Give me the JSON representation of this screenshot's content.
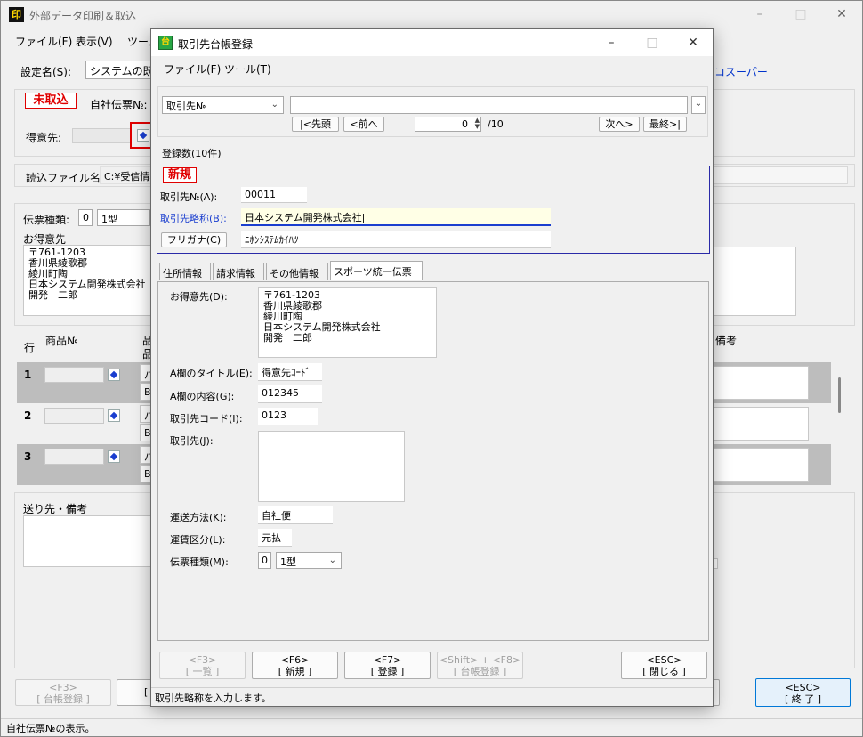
{
  "main": {
    "title": "外部データ印刷＆取込",
    "menu": [
      "ファイル(F)",
      "表示(V)",
      "ツール"
    ],
    "setting_label": "設定名(S):",
    "setting_value": "システムの既定",
    "link_right": "コスーパー",
    "status_badge": "未取込",
    "slip_no_label": "自社伝票№:",
    "customer_label": "得意先:",
    "file_label": "読込ファイル名:",
    "file_value": "C:¥受信情報",
    "slip_type_label": "伝票種類:",
    "slip_type_code": "0",
    "slip_type_value": "1型",
    "okyakusaki_label": "お得意先",
    "okyakusaki_text": "〒761-1203\n香川県綾歌郡\n綾川町陶\n日本システム開発株式会社\n開発　二郎",
    "grid_row_header": "行",
    "grid_product_header": "商品№",
    "grid_product2_header": "品",
    "grid_product3_header": "品",
    "grid_biko_header": "備考",
    "rows": [
      {
        "no": "1",
        "p1": "パ",
        "p2": "B"
      },
      {
        "no": "2",
        "p1": "パ",
        "p2": "B"
      },
      {
        "no": "3",
        "p1": "パ",
        "p2": "B"
      }
    ],
    "okuri_label": "送り先・備考",
    "f3_key": "<F3>",
    "f3_label": "[ 台帳登録 ]",
    "f_hidden_label": "[",
    "esc_key": "<ESC>",
    "esc_label": "[ 終 了 ]",
    "status_bar": "自社伝票№の表示。"
  },
  "dialog": {
    "title": "取引先台帳登録",
    "menu": [
      "ファイル(F)",
      "ツール(T)"
    ],
    "search_field": "取引先№",
    "nav_first": "|<先頭",
    "nav_prev": "<前へ",
    "nav_pos": "0",
    "nav_total": "/10",
    "nav_next": "次へ>",
    "nav_last": "最終>|",
    "count_label": "登録数(10件)",
    "new_badge": "新規",
    "torihiki_no_label": "取引先№(A):",
    "torihiki_no_value": "00011",
    "ryakusho_label": "取引先略称(B):",
    "ryakusho_value": "日本システム開発株式会社",
    "furigana_button": "フリガナ(C)",
    "furigana_value": "ﾆﾎﾝｼｽﾃﾑｶｲﾊﾂ",
    "tabs": [
      "住所情報",
      "請求情報",
      "その他情報",
      "スポーツ統一伝票"
    ],
    "okyakusaki_label": "お得意先(D):",
    "okyakusaki_text": "〒761-1203\n香川県綾歌郡\n綾川町陶\n日本システム開発株式会社\n開発　二郎",
    "a_title_label": "A欄のタイトル(E):",
    "a_title_value": "得意先ｺｰﾄﾞ",
    "a_content_label": "A欄の内容(G):",
    "a_content_value": "012345",
    "torihiki_code_label": "取引先コード(I):",
    "torihiki_code_value": "0123",
    "torihiki_label": "取引先(J):",
    "unso_label": "運送方法(K):",
    "unso_value": "自社便",
    "unchin_label": "運賃区分(L):",
    "unchin_value": "元払",
    "denpyo_label": "伝票種類(M):",
    "denpyo_code": "0",
    "denpyo_value": "1型",
    "f3_key": "<F3>",
    "f3_label": "[ 一覧 ]",
    "f6_key": "<F6>",
    "f6_label": "[ 新規 ]",
    "f7_key": "<F7>",
    "f7_label": "[ 登録 ]",
    "sf8_key": "<Shift> + <F8>",
    "sf8_label": "[ 台帳登録 ]",
    "esc_key": "<ESC>",
    "esc_label": "[ 閉じる ]",
    "status_bar": "取引先略称を入力します。"
  },
  "colors": {
    "accent_blue": "#1a3ecf",
    "badge_red": "#e00000",
    "focus_yellow": "#ffffe6"
  }
}
